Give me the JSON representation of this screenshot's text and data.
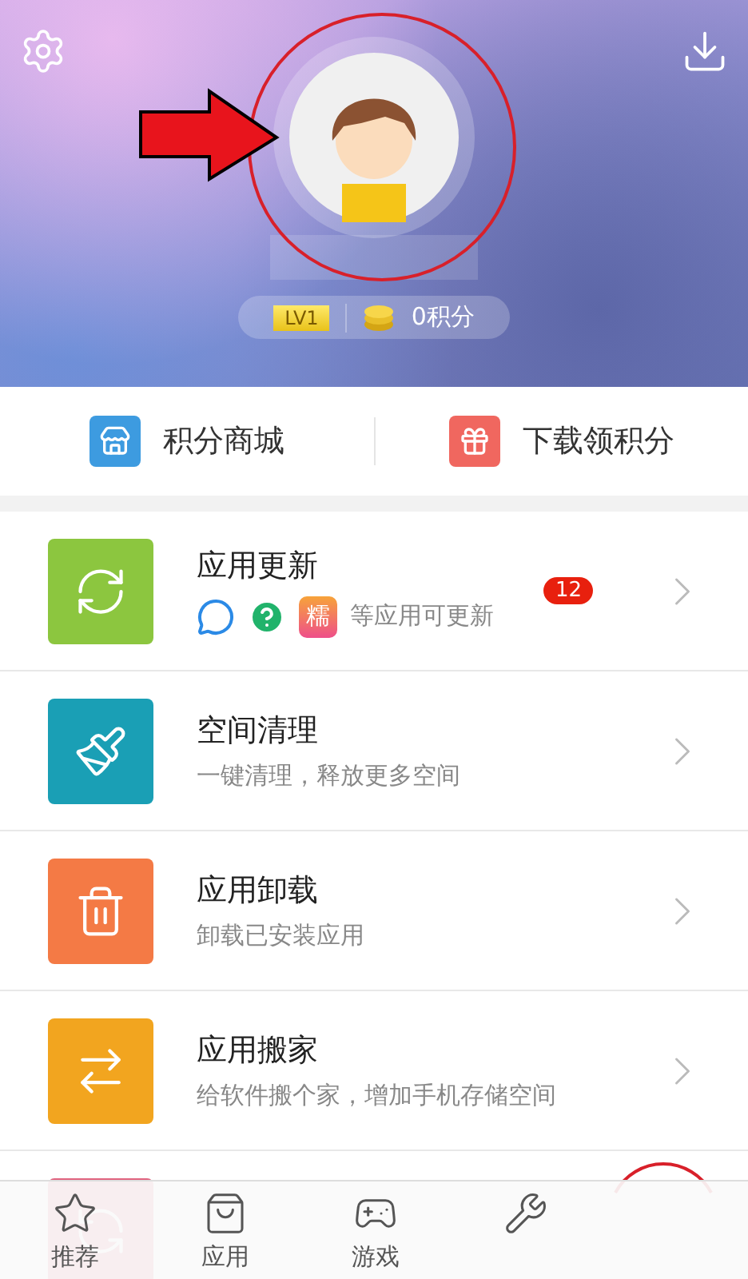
{
  "header": {
    "level_badge": "LV1",
    "points": "0积分"
  },
  "shortcuts": [
    {
      "label": "积分商城",
      "kind": "store",
      "color": "#3d9be0"
    },
    {
      "label": "下载领积分",
      "kind": "gift",
      "color": "#f0675f"
    }
  ],
  "rows": [
    {
      "kind": "update",
      "title": "应用更新",
      "subtitle": "等应用可更新",
      "badge": "12",
      "color": "#8cc63f",
      "app_icons": [
        {
          "kind": "chat"
        },
        {
          "kind": "help"
        },
        {
          "kind": "tile",
          "glyph": "糯"
        }
      ]
    },
    {
      "kind": "clean",
      "title": "空间清理",
      "subtitle": "一键清理，释放更多空间",
      "color": "#1a9fb5"
    },
    {
      "kind": "uninstall",
      "title": "应用卸载",
      "subtitle": "卸载已安装应用",
      "color": "#f47a45"
    },
    {
      "kind": "move",
      "title": "应用搬家",
      "subtitle": "给软件搬个家，增加手机存储空间",
      "color": "#f2a51f"
    },
    {
      "kind": "sync",
      "color": "#e0637f"
    }
  ],
  "tabs": [
    {
      "kind": "star",
      "label": "推荐",
      "selected": false
    },
    {
      "kind": "bag",
      "label": "应用",
      "selected": false
    },
    {
      "kind": "game",
      "label": "游戏",
      "selected": false
    },
    {
      "kind": "manage",
      "selected": false
    }
  ]
}
